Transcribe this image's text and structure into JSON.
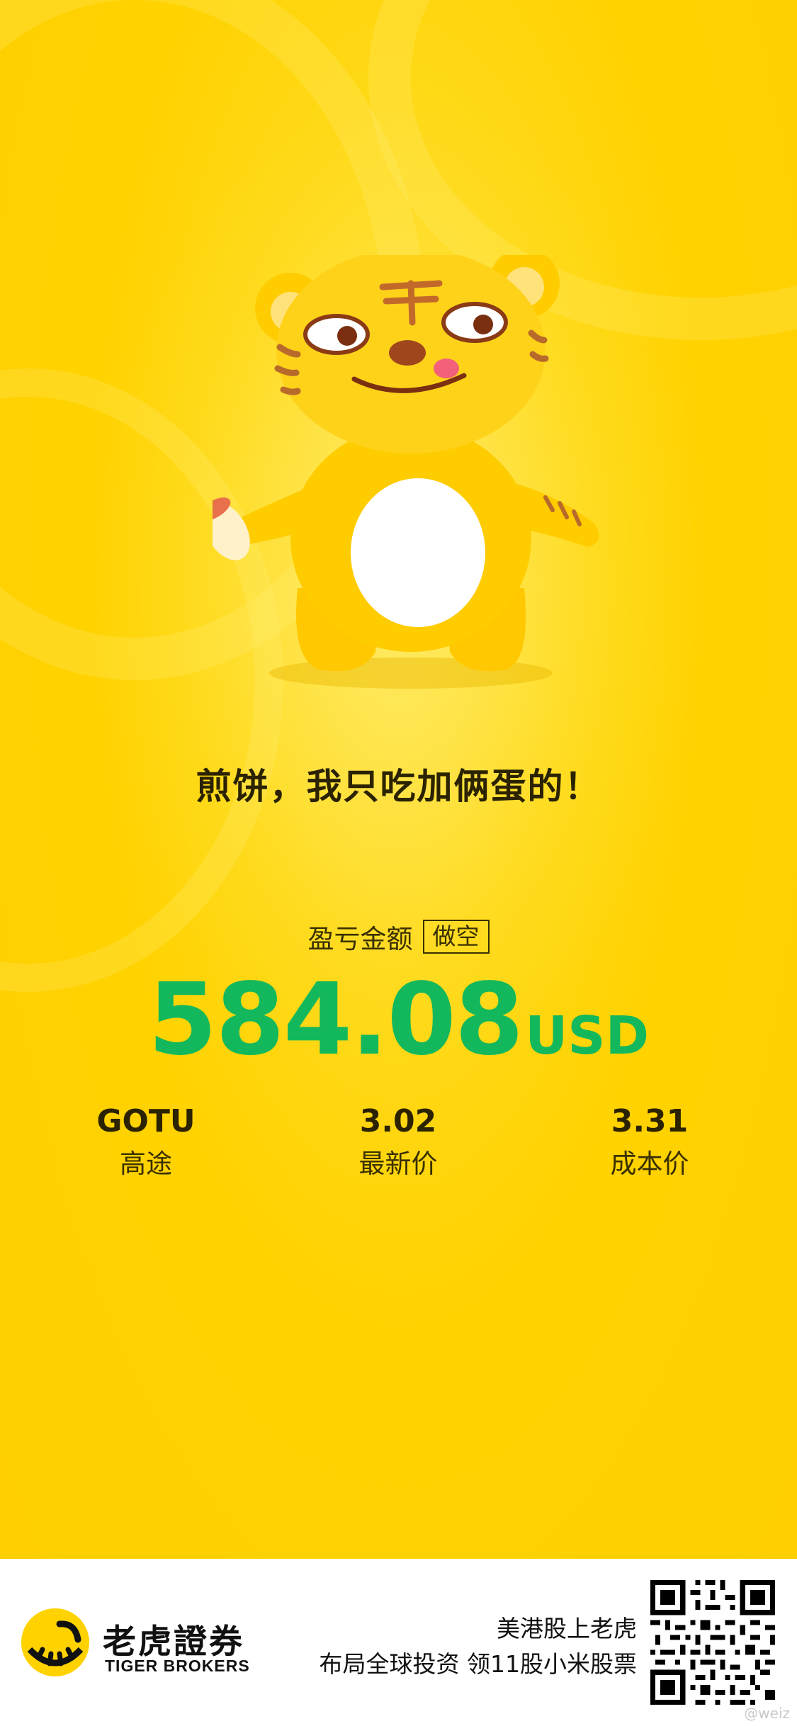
{
  "poster": {
    "slogan": "煎饼，我只吃加俩蛋的！",
    "pnl_label": "盈亏金额",
    "position_type": "做空",
    "pnl_value": "584.08",
    "pnl_currency": "USD",
    "stats": [
      {
        "top": "GOTU",
        "bottom": "高途"
      },
      {
        "top": "3.02",
        "bottom": "最新价"
      },
      {
        "top": "3.31",
        "bottom": "成本价"
      }
    ]
  },
  "footer": {
    "brand_name": "老虎證券",
    "brand_sub": "TIGER BROKERS",
    "promo_line1": "美港股上老虎",
    "promo_line2": "布局全球投资 领11股小米股票",
    "watermark": "@weiz"
  },
  "colors": {
    "background_yellow": "#ffd200",
    "pnl_green": "#13b85c",
    "footer_bg": "#ffffff"
  },
  "icons": {
    "mascot": "tiger-mascot-illustration",
    "logo": "tiger-logo-icon",
    "qr": "qr-code-icon"
  }
}
